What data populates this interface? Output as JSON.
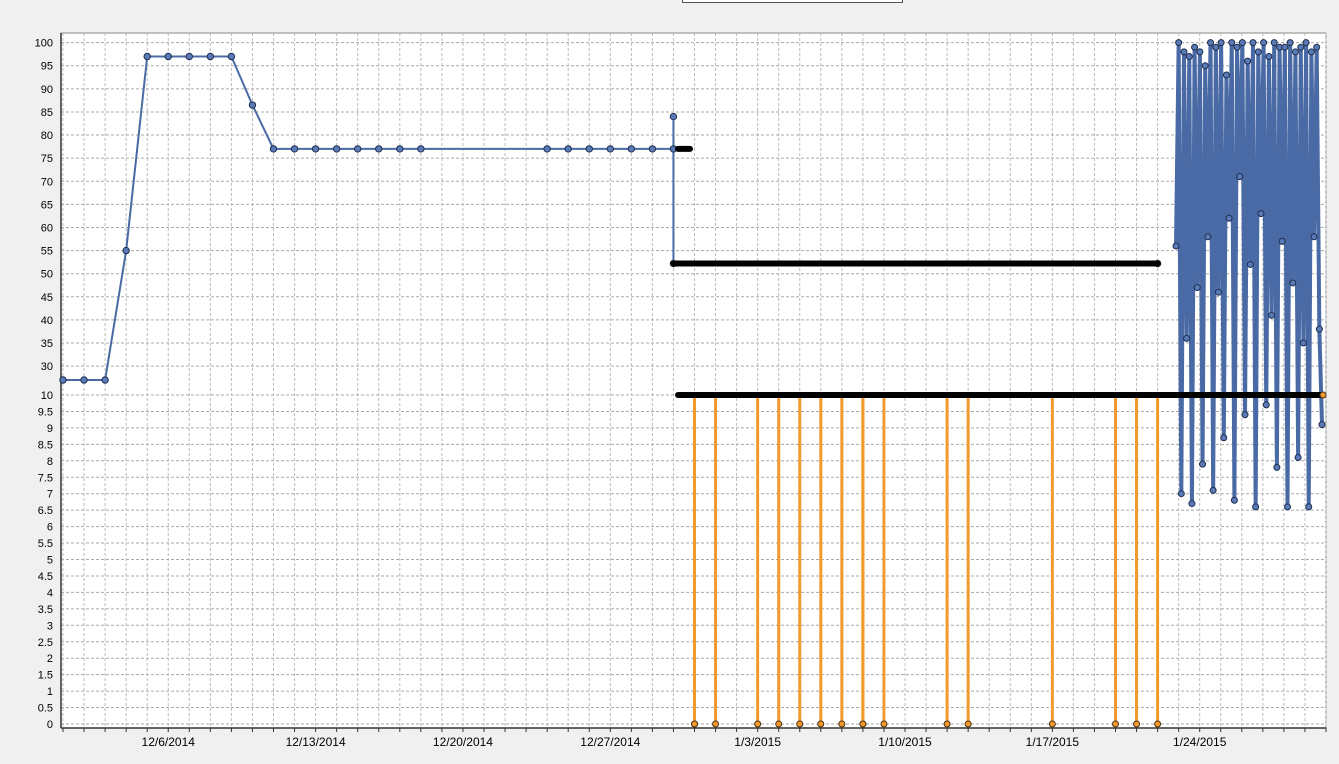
{
  "chart_data": {
    "type": "line",
    "title": "",
    "xlabel": "",
    "ylabel": "",
    "x_tick_labels": [
      "12/6/2014",
      "12/13/2014",
      "12/20/2014",
      "12/27/2014",
      "1/3/2015",
      "1/10/2015",
      "1/17/2015",
      "1/24/2015"
    ],
    "panels": [
      {
        "name": "upper",
        "ylim": [
          27,
          101
        ],
        "y_ticks": [
          30,
          35,
          40,
          45,
          50,
          55,
          60,
          65,
          70,
          75,
          80,
          85,
          90,
          95,
          100
        ],
        "series": [
          {
            "color": "#4a6aa5",
            "marker": "circle",
            "points": [
              [
                "2014-12-01",
                27
              ],
              [
                "2014-12-02",
                27
              ],
              [
                "2014-12-03",
                27
              ],
              [
                "2014-12-04",
                55
              ],
              [
                "2014-12-05",
                97
              ],
              [
                "2014-12-06",
                97
              ],
              [
                "2014-12-07",
                97
              ],
              [
                "2014-12-08",
                97
              ],
              [
                "2014-12-09",
                97
              ],
              [
                "2014-12-10",
                86.5
              ],
              [
                "2014-12-11",
                77
              ],
              [
                "2014-12-12",
                77
              ],
              [
                "2014-12-13",
                77
              ],
              [
                "2014-12-14",
                77
              ],
              [
                "2014-12-15",
                77
              ],
              [
                "2014-12-16",
                77
              ],
              [
                "2014-12-17",
                77
              ],
              [
                "2014-12-18",
                77
              ],
              [
                "2014-12-24",
                77
              ],
              [
                "2014-12-25",
                77
              ],
              [
                "2014-12-26",
                77
              ],
              [
                "2014-12-27",
                77
              ],
              [
                "2014-12-28",
                77
              ],
              [
                "2014-12-29",
                77
              ],
              [
                "2014-12-30",
                77
              ],
              [
                "2014-12-30",
                84
              ],
              [
                "2014-12-30",
                52.2
              ],
              [
                "2015-01-22",
                52.2
              ]
            ]
          },
          {
            "color": "#4a6aa5",
            "marker": "circle",
            "note_range": "dense oscillation between 0 and 100 from 1/22/2015 to 1/29/2015",
            "points": [
              [
                "2015-01-22",
                56
              ],
              [
                "2015-01-22",
                100
              ],
              [
                "2015-01-22",
                7
              ],
              [
                "2015-01-22",
                98
              ],
              [
                "2015-01-23",
                36
              ],
              [
                "2015-01-23",
                97
              ],
              [
                "2015-01-23",
                6.7
              ],
              [
                "2015-01-23",
                99
              ],
              [
                "2015-01-23",
                47
              ],
              [
                "2015-01-23",
                98
              ],
              [
                "2015-01-23",
                7.9
              ],
              [
                "2015-01-23",
                95
              ],
              [
                "2015-01-24",
                58
              ],
              [
                "2015-01-24",
                100
              ],
              [
                "2015-01-24",
                7.1
              ],
              [
                "2015-01-24",
                99
              ],
              [
                "2015-01-24",
                46
              ],
              [
                "2015-01-24",
                100
              ],
              [
                "2015-01-24",
                8.7
              ],
              [
                "2015-01-24",
                93
              ],
              [
                "2015-01-25",
                62
              ],
              [
                "2015-01-25",
                100
              ],
              [
                "2015-01-25",
                6.8
              ],
              [
                "2015-01-25",
                99
              ],
              [
                "2015-01-25",
                71
              ],
              [
                "2015-01-25",
                100
              ],
              [
                "2015-01-25",
                9.4
              ],
              [
                "2015-01-25",
                96
              ],
              [
                "2015-01-26",
                52
              ],
              [
                "2015-01-26",
                100
              ],
              [
                "2015-01-26",
                6.6
              ],
              [
                "2015-01-26",
                98
              ],
              [
                "2015-01-26",
                63
              ],
              [
                "2015-01-26",
                100
              ],
              [
                "2015-01-26",
                9.7
              ],
              [
                "2015-01-26",
                97
              ],
              [
                "2015-01-27",
                41
              ],
              [
                "2015-01-27",
                100
              ],
              [
                "2015-01-27",
                7.8
              ],
              [
                "2015-01-27",
                99
              ],
              [
                "2015-01-27",
                57
              ],
              [
                "2015-01-27",
                99
              ],
              [
                "2015-01-27",
                6.6
              ],
              [
                "2015-01-27",
                100
              ],
              [
                "2015-01-28",
                48
              ],
              [
                "2015-01-28",
                98
              ],
              [
                "2015-01-28",
                8.1
              ],
              [
                "2015-01-28",
                99
              ],
              [
                "2015-01-28",
                35
              ],
              [
                "2015-01-28",
                100
              ],
              [
                "2015-01-28",
                6.6
              ],
              [
                "2015-01-28",
                98
              ],
              [
                "2015-01-29",
                58
              ],
              [
                "2015-01-29",
                99
              ],
              [
                "2015-01-29",
                38
              ],
              [
                "2015-01-29",
                9.1
              ]
            ]
          },
          {
            "color": "#000000",
            "marker": "circle",
            "points": [
              [
                "2014-12-30",
                52.2
              ],
              [
                "2015-01-22",
                52.2
              ]
            ]
          }
        ]
      },
      {
        "name": "lower",
        "ylim": [
          0,
          10
        ],
        "y_ticks": [
          0,
          0.5,
          1,
          1.5,
          2,
          2.5,
          3,
          3.5,
          4,
          4.5,
          5,
          5.5,
          6,
          6.5,
          7,
          7.5,
          8,
          8.5,
          9,
          9.5,
          10
        ],
        "series": [
          {
            "color": "#000000",
            "marker": "circle",
            "points": [
              [
                "2014-12-30",
                10
              ],
              [
                "2015-01-29",
                10
              ]
            ]
          },
          {
            "color": "#f29a2e",
            "marker": "circle",
            "style": "impulse from 10 down to 0",
            "x": [
              "2014-12-31",
              "2014-12-31",
              "2015-01-01",
              "2015-01-03",
              "2015-01-04",
              "2015-01-05",
              "2015-01-06",
              "2015-01-07",
              "2015-01-08",
              "2015-01-08",
              "2015-01-09",
              "2015-01-12",
              "2015-01-13",
              "2015-01-17",
              "2015-01-20",
              "2015-01-21",
              "2015-01-22"
            ],
            "y_top": 10,
            "y_bottom": 0
          }
        ]
      }
    ],
    "x_range": [
      "2014-12-01",
      "2015-01-30"
    ],
    "grid": true,
    "legend": "none"
  }
}
